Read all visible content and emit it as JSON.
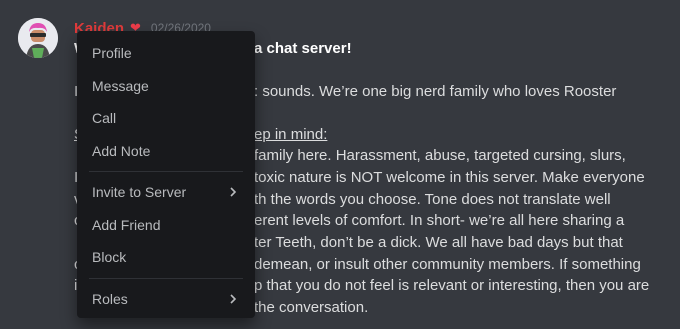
{
  "message": {
    "username": "Kaiden",
    "timestamp": "02/26/2020",
    "lines": [
      {
        "text": "W",
        "hidden": "a chat server!"
      },
      {
        "text": "I",
        "hidden": ": sounds. We’re one big nerd family who loves Rooster"
      },
      {
        "text": "S",
        "hidden": "ep in mind:"
      },
      {
        "text": "",
        "hidden": "family here. Harassment, abuse, targeted cursing, slurs,"
      },
      {
        "text": "I",
        "hidden": "toxic nature is NOT welcome in this server. Make everyone"
      },
      {
        "text": "v",
        "hidden": "th the words you choose. Tone does not translate well"
      },
      {
        "text": "c",
        "hidden": "erent levels of comfort. In short- we’re all here sharing a"
      },
      {
        "text": "",
        "hidden": "ter Teeth, don’t be a dick. We all have bad days but that"
      },
      {
        "text": "c",
        "hidden": "demean, or insult other community members. If something"
      },
      {
        "text": "i",
        "hidden": "p that you do not feel is relevant or interesting, then you are"
      },
      {
        "text": "",
        "hidden": "the conversation."
      }
    ]
  },
  "context_menu": {
    "items": [
      {
        "label": "Profile",
        "submenu": false
      },
      {
        "label": "Message",
        "submenu": false
      },
      {
        "label": "Call",
        "submenu": false
      },
      {
        "label": "Add Note",
        "submenu": false
      },
      {
        "label": "Invite to Server",
        "submenu": true
      },
      {
        "label": "Add Friend",
        "submenu": false
      },
      {
        "label": "Block",
        "submenu": false
      },
      {
        "label": "Roles",
        "submenu": true
      }
    ]
  },
  "colors": {
    "background": "#36393f",
    "menu_background": "#18191c",
    "username": "#e03b3b",
    "text": "#dcddde",
    "menu_text": "#b9bbbe"
  }
}
